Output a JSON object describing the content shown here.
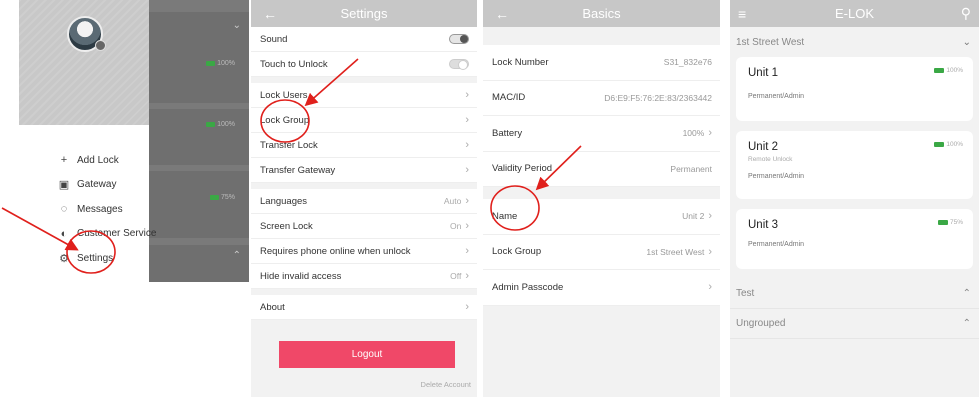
{
  "drawer": {
    "menu": [
      {
        "icon": "plus-icon",
        "glyph": "+",
        "label": "Add Lock"
      },
      {
        "icon": "gateway-icon",
        "glyph": "▣",
        "label": "Gateway"
      },
      {
        "icon": "message-icon",
        "glyph": "◌",
        "label": "Messages"
      },
      {
        "icon": "headset-icon",
        "glyph": "◐",
        "label": "Customer Service"
      },
      {
        "icon": "gear-icon",
        "glyph": "⚙",
        "label": "Settings"
      }
    ],
    "overlay_batteries": [
      "100%",
      "100%",
      "75%"
    ]
  },
  "settings": {
    "title": "Settings",
    "rows": {
      "sound": "Sound",
      "touch_to_unlock": "Touch to Unlock",
      "lock_users": "Lock Users",
      "lock_group": "Lock Group",
      "transfer_lock": "Transfer Lock",
      "transfer_gateway": "Transfer Gateway",
      "languages": "Languages",
      "languages_val": "Auto",
      "screen_lock": "Screen Lock",
      "screen_lock_val": "On",
      "requires_online": "Requires phone online when unlock",
      "hide_invalid": "Hide invalid access",
      "hide_invalid_val": "Off",
      "about": "About"
    },
    "logout": "Logout",
    "delete_account": "Delete Account"
  },
  "basics": {
    "title": "Basics",
    "rows": {
      "lock_number": "Lock Number",
      "lock_number_val": "S31_832e76",
      "mac": "MAC/ID",
      "mac_val": "D6:E9:F5:76:2E:83/2363442",
      "battery": "Battery",
      "battery_val": "100%",
      "validity": "Validity Period",
      "validity_val": "Permanent",
      "name": "Name",
      "name_val": "Unit 2",
      "lock_group": "Lock Group",
      "lock_group_val": "1st Street West",
      "admin_passcode": "Admin Passcode"
    }
  },
  "elok": {
    "title": "E-LOK",
    "group_main": "1st Street West",
    "units": [
      {
        "name": "Unit 1",
        "sub": "",
        "role": "Permanent/Admin",
        "battery": "100%"
      },
      {
        "name": "Unit 2",
        "sub": "Remote Unlock",
        "role": "Permanent/Admin",
        "battery": "100%"
      },
      {
        "name": "Unit 3",
        "sub": "",
        "role": "Permanent/Admin",
        "battery": "75%"
      }
    ],
    "groups": [
      "Test",
      "Ungrouped"
    ]
  },
  "colors": {
    "accent": "#f04868",
    "topbar": "#c7c7c7",
    "battery": "#3aa845",
    "annotation": "#e0201c"
  }
}
